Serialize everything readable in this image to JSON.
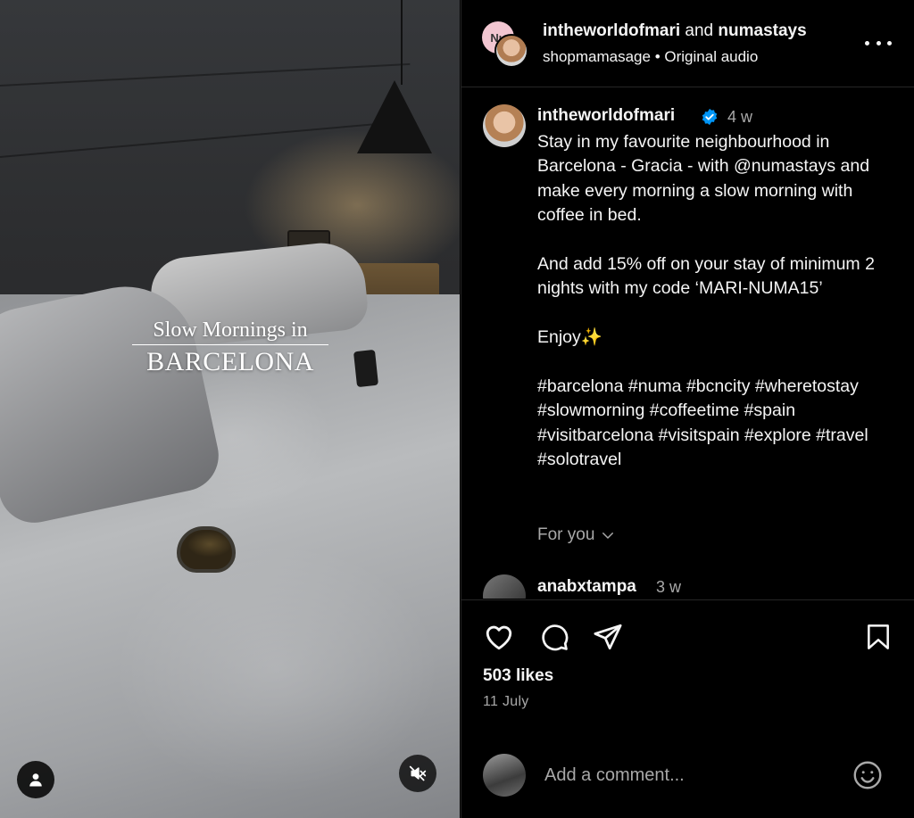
{
  "media": {
    "overlay_line1": "Slow Mornings in",
    "overlay_line2": "BARCELONA",
    "user_tag_icon": "person-icon",
    "mute_icon": "speaker-muted-icon"
  },
  "header": {
    "author": "intheworldofmari",
    "connector": "and",
    "collaborator": "numastays",
    "avatar_back_initials": "Nu",
    "audio_account": "shopmamasage",
    "separator": "•",
    "audio_label": "Original audio",
    "more_icon": "more-horizontal-icon"
  },
  "caption": {
    "username": "intheworldofmari",
    "verified_icon": "verified-badge-icon",
    "time": "4 w",
    "paragraphs": [
      "Stay in my favourite neighbourhood in Barcelona - Gracia - with @numastays and make every morning a slow morning with coffee in bed.",
      "And add 15% off on your stay of minimum 2 nights with my code ‘MARI-NUMA15’",
      "Enjoy✨",
      "#barcelona #numa #bcncity #wheretostay #slowmorning #coffeetime #spain #visitbarcelona #visitspain #explore #travel #solotravel"
    ],
    "for_you": "For you"
  },
  "comment": {
    "username": "anabxtampa",
    "time": "3 w"
  },
  "actions": {
    "like_icon": "heart-icon",
    "comment_icon": "comment-bubble-icon",
    "share_icon": "paper-plane-icon",
    "save_icon": "bookmark-icon",
    "likes": "503 likes",
    "date": "11 July"
  },
  "add_comment": {
    "placeholder": "Add a comment...",
    "emoji_icon": "smiley-icon"
  },
  "colors": {
    "background": "#000000",
    "text_primary": "#f5f5f5",
    "text_secondary": "#a8a8a8",
    "divider": "#262626",
    "verified_blue": "#0095f6"
  }
}
